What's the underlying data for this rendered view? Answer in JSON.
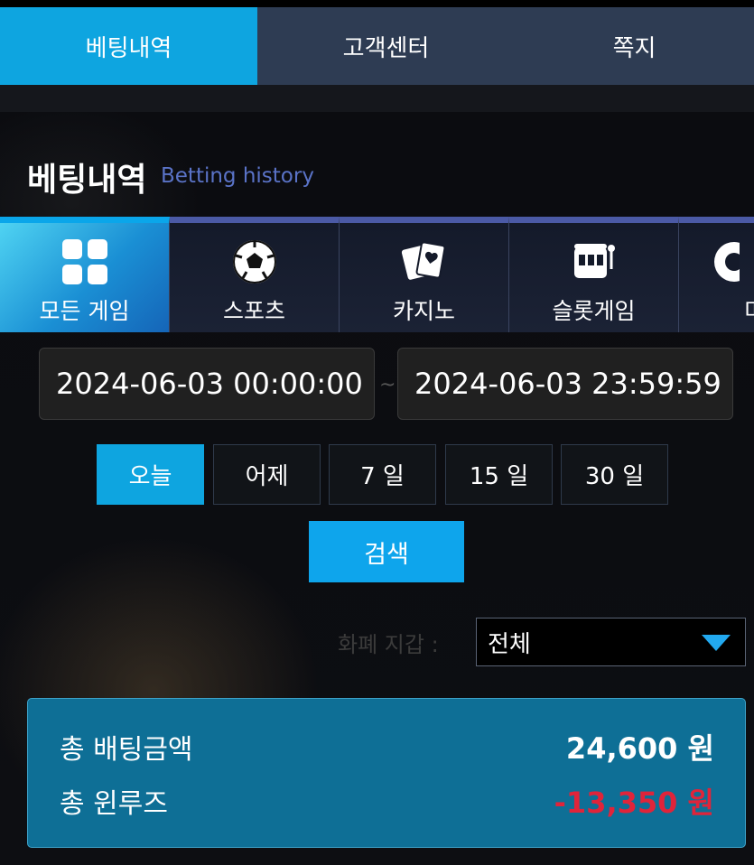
{
  "topnav": {
    "tabs": [
      {
        "label": "베팅내역",
        "active": true
      },
      {
        "label": "고객센터",
        "active": false
      },
      {
        "label": "쪽지",
        "active": false
      }
    ]
  },
  "page": {
    "title": "베팅내역",
    "subtitle": "Betting history"
  },
  "categories": [
    {
      "label": "모든 게임",
      "icon": "grid-icon",
      "active": true
    },
    {
      "label": "스포츠",
      "icon": "soccer-ball-icon",
      "active": false
    },
    {
      "label": "카지노",
      "icon": "playing-cards-icon",
      "active": false
    },
    {
      "label": "슬롯게임",
      "icon": "slot-machine-icon",
      "active": false
    },
    {
      "label": "미",
      "icon": "partial-icon",
      "active": false
    }
  ],
  "date_range": {
    "start": "2024-06-03 00:00:00",
    "separator": "~",
    "end": "2024-06-03 23:59:59"
  },
  "quick_ranges": [
    {
      "label": "오늘",
      "active": true
    },
    {
      "label": "어제",
      "active": false
    },
    {
      "label": "7 일",
      "active": false
    },
    {
      "label": "15 일",
      "active": false
    },
    {
      "label": "30 일",
      "active": false
    }
  ],
  "search_label": "검색",
  "wallet": {
    "label": "화폐 지갑 :",
    "selected": "전체"
  },
  "summary": {
    "total_bet_label": "총 배팅금액",
    "total_bet_value": "24,600 원",
    "total_winloss_label": "총 윈루즈",
    "total_winloss_value": "-13,350 원"
  },
  "colors": {
    "accent": "#0ea5e0",
    "negative": "#e0243a",
    "summary_bg": "#0e6f96"
  }
}
